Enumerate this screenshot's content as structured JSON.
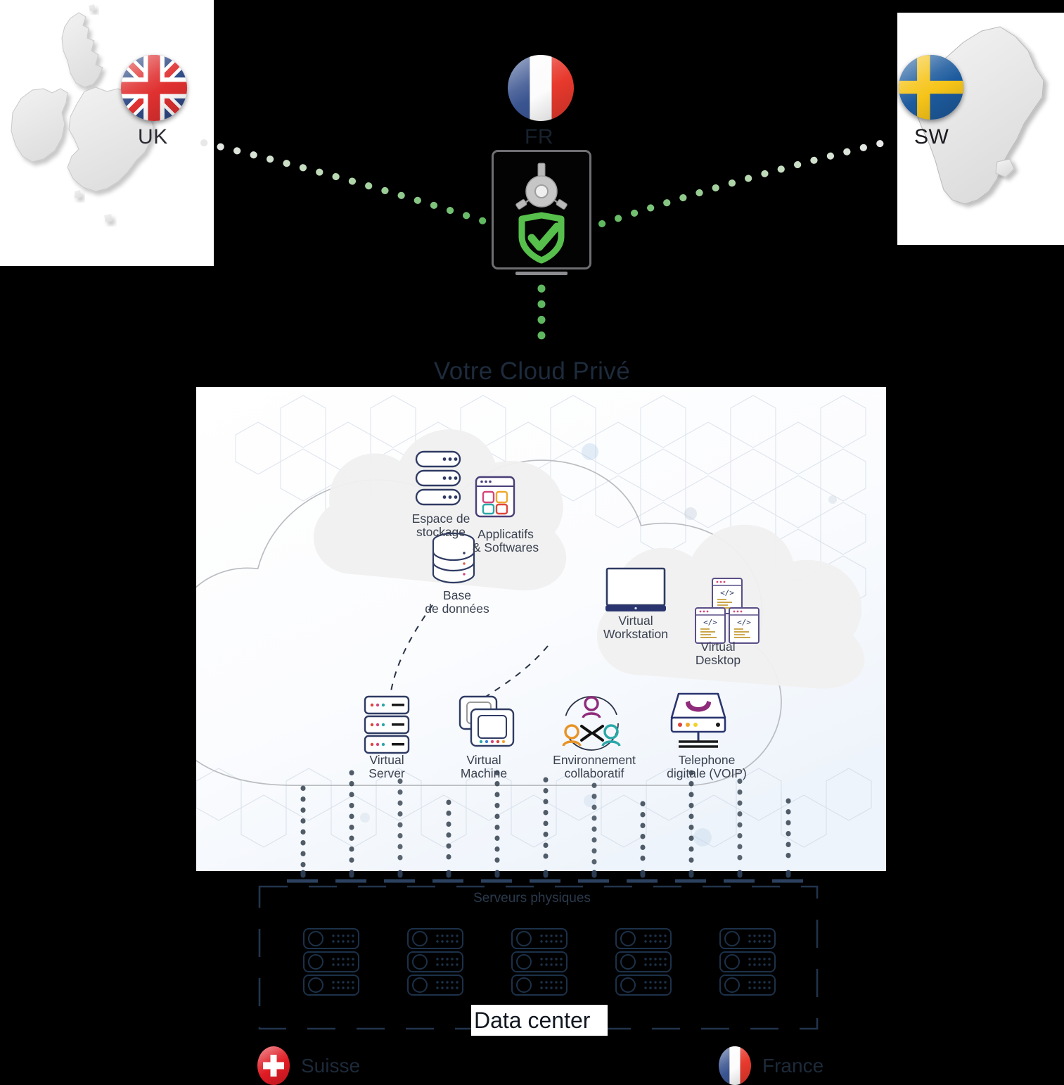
{
  "diagram": {
    "title_private_cloud": "Votre Cloud Privé",
    "datacenter_section_title": "Serveurs physiques",
    "datacenter_label": "Data center"
  },
  "countries": [
    {
      "code": "UK",
      "flag": "uk-flag-icon",
      "map": "united-kingdom-map"
    },
    {
      "code": "FR",
      "flag": "france-flag-icon",
      "map": null
    },
    {
      "code": "SW",
      "flag": "sweden-flag-icon",
      "map": "sweden-map"
    }
  ],
  "gateway": {
    "hub_icon": "network-hub-icon",
    "shield_icon": "green-shield-check-icon",
    "screen_icon": "monitor-icon"
  },
  "cloud_services": {
    "upper_left_group": [
      {
        "label": "Espace de\nstockage",
        "icon": "storage-stack-icon"
      },
      {
        "label": "Applicatifs\n& Softwares",
        "icon": "apps-window-icon"
      },
      {
        "label": "Base\nde données",
        "icon": "database-cylinder-icon"
      }
    ],
    "upper_right_group": [
      {
        "label": "Virtual\nWorkstation",
        "icon": "monitor-screen-icon"
      },
      {
        "label": "Virtual\nDesktop",
        "icon": "code-windows-icon"
      }
    ],
    "bottom_row": [
      {
        "label": "Virtual\nServer",
        "icon": "server-rack-icon"
      },
      {
        "label": "Virtual\nMachine",
        "icon": "stacked-windows-icon"
      },
      {
        "label": "Environnement\ncollaboratif",
        "icon": "collaboration-users-icon"
      },
      {
        "label": "Telephone\ndigitale (VOIP)",
        "icon": "voip-phone-icon"
      }
    ]
  },
  "datacenter": {
    "rack_groups": 5,
    "units_per_rack": 3
  },
  "locations": [
    {
      "label": "Suisse",
      "flag": "switzerland-flag-icon"
    },
    {
      "label": "France",
      "flag": "france-flag-icon"
    }
  ],
  "colors": {
    "background": "#000000",
    "link_green": "#6dbf6d",
    "title_blue": "#1d2b3c",
    "icon_navy": "#2f3b63",
    "datacenter_outline": "#1b2b42",
    "panel_white": "#ffffff"
  }
}
